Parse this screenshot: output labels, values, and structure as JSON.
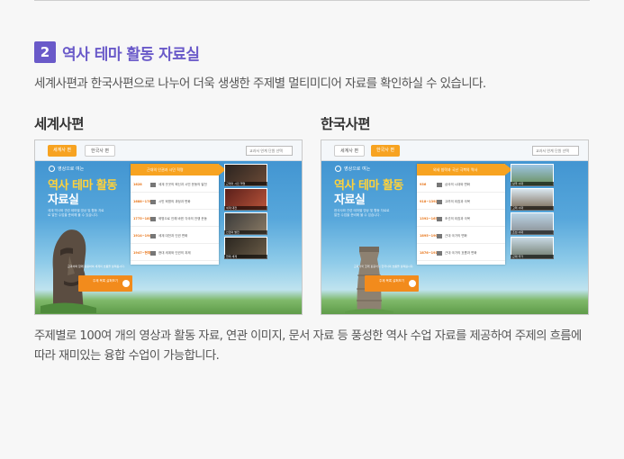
{
  "section": {
    "number": "2",
    "title": "역사 테마 활동 자료실",
    "intro": "세계사편과 한국사편으로 나누어 더욱 생생한 주제별 멀티미디어 자료를 확인하실 수 있습니다."
  },
  "columns": {
    "world_label": "세계사편",
    "korea_label": "한국사편"
  },
  "description": "주제별로 100여 개의 영상과 활동 자료, 연관 이미지, 문서 자료 등 풍성한 역사 수업 자료를 제공하여 주제의 흐름에 따라 재미있는 융합 수업이 가능합니다.",
  "screens": {
    "tabs": [
      "세계사 편",
      "한국사 편"
    ],
    "select_placeholder": "교과서 연계 단원 선택",
    "logo_text": "영상으로 여는",
    "title_line1": "역사 테마 활동",
    "title_line2": "자료실",
    "world": {
      "desc": "세계 역사와 관련 테마별 영상 및 활동 자료로 알찬 수업을 준비해 볼 수 있습니다.",
      "panel_head": "근대의 인권과 시민 혁명",
      "rows": [
        {
          "year": "1628",
          "text": "세계 곳곳의 혁신과 시민 운동의 발전"
        },
        {
          "year": "1688~1789",
          "text": "시민 혁명의 과정과 변화"
        },
        {
          "year": "1775~1812",
          "text": "혁명으로 인해 바뀐 각국의 전쟁 운동"
        },
        {
          "year": "1914~1945",
          "text": "세계 대전과 인권 변화"
        },
        {
          "year": "1947~현재",
          "text": "현대 세계와 인권의 과제"
        }
      ],
      "note": "교과서와 함께 활용하여 세계의 흐름을 살펴봅시다.",
      "cta": "주제 목록 살펴보기",
      "thumb_caps": [
        "근대의 시민 혁명",
        "세계 대전",
        "인권의 발전",
        "현대 세계"
      ]
    },
    "korea": {
      "desc": "한국사와 관련 테마별 영상 및 활동 자료로 알찬 수업을 준비해 볼 수 있습니다.",
      "panel_head": "외세 침략과 국난 극복의 역사",
      "rows": [
        {
          "year": "936",
          "text": "삼국의 시대와 변화"
        },
        {
          "year": "918~1392",
          "text": "고려의 외침과 극복"
        },
        {
          "year": "1392~1636",
          "text": "조선의 외침과 극복"
        },
        {
          "year": "1895~1905",
          "text": "근대 국가의 변화"
        },
        {
          "year": "1876~1910",
          "text": "근대 국가의 흐름과 변화"
        }
      ],
      "note": "교과서와 함께 활용하여 한국사의 흐름을 살펴봅시다.",
      "cta": "주제 목록 살펴보기",
      "thumb_caps": [
        "삼국 시대",
        "고려 시대",
        "조선 시대",
        "근대 국가"
      ]
    }
  },
  "colors": {
    "accent": "#6a5ac9",
    "orange": "#f7a321",
    "title_yellow": "#ffd23a"
  }
}
